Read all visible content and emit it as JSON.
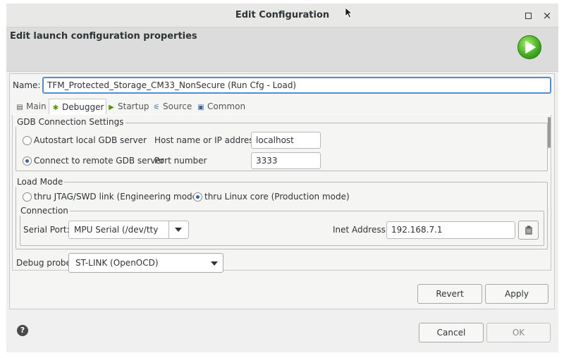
{
  "window": {
    "title": "Edit Configuration",
    "maximize_glyph": "▫",
    "close_glyph": "×"
  },
  "header": {
    "title": "Edit launch configuration properties",
    "icon": "run-icon"
  },
  "name_field": {
    "label": "Name:",
    "value": "TFM_Protected_Storage_CM33_NonSecure (Run Cfg - Load)"
  },
  "tabs": [
    {
      "label": "Main",
      "icon": "main-tab-icon",
      "active": false
    },
    {
      "label": "Debugger",
      "icon": "debugger-tab-icon",
      "active": true
    },
    {
      "label": "Startup",
      "icon": "startup-tab-icon",
      "active": false
    },
    {
      "label": "Source",
      "icon": "source-tab-icon",
      "active": false
    },
    {
      "label": "Common",
      "icon": "common-tab-icon",
      "active": false
    }
  ],
  "gdb": {
    "group_label": "GDB Connection Settings",
    "autostart_label": "Autostart local GDB server",
    "remote_label": "Connect to remote GDB server",
    "selected": "remote",
    "host_label": "Host name or IP address",
    "host_value": "localhost",
    "port_label": "Port number",
    "port_value": "3333"
  },
  "load_mode": {
    "group_label": "Load Mode",
    "jtag_label": "thru JTAG/SWD link (Engineering mode)",
    "linux_label": "thru Linux core (Production mode)",
    "selected": "linux",
    "connection": {
      "group_label": "Connection",
      "serial_label": "Serial Port:",
      "serial_value": "MPU Serial (/dev/tty",
      "inet_label": "Inet Address:",
      "inet_value": "192.168.7.1"
    }
  },
  "debug_probe": {
    "label": "Debug probe",
    "value": "ST-LINK (OpenOCD)"
  },
  "buttons": {
    "revert": "Revert",
    "apply": "Apply",
    "cancel": "Cancel",
    "ok": "OK"
  },
  "help": {
    "glyph": "?"
  }
}
